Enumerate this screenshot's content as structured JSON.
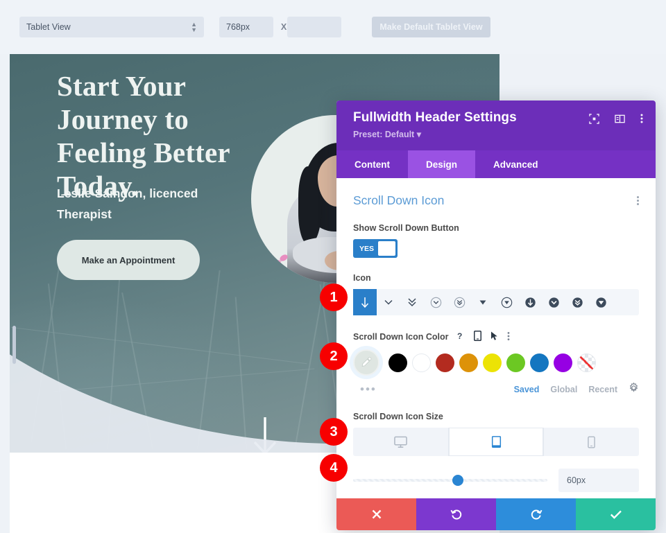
{
  "toolbar": {
    "view_select": "Tablet View",
    "width_value": "768px",
    "multiply_symbol": "X",
    "height_value": "",
    "make_default_button": "Make Default Tablet View"
  },
  "preview": {
    "heading": "Start Your Journey to Feeling Better Today.",
    "subheading": "Leslie Saindon, licenced Therapist",
    "cta_button": "Make an Appointment",
    "scroll_arrow_icon": "arrow-down-icon",
    "hero_bg_color": "#5a777b"
  },
  "modal": {
    "title": "Fullwidth Header Settings",
    "preset": "Preset: Default",
    "header_icons": [
      "target-icon",
      "layout-icon",
      "kebab-menu-icon"
    ],
    "tabs": [
      {
        "label": "Content",
        "active": false
      },
      {
        "label": "Design",
        "active": true
      },
      {
        "label": "Advanced",
        "active": false
      }
    ],
    "section": {
      "title": "Scroll Down Icon",
      "kebab": "kebab-menu-icon"
    },
    "show_scroll_down": {
      "label": "Show Scroll Down Button",
      "toggle_value": "YES",
      "toggle_on": true,
      "accent": "#2a7fc9"
    },
    "icon_field": {
      "label": "Icon",
      "selected_index": 0,
      "options": [
        "arrow-down-icon",
        "chevron-down-icon",
        "double-chevron-down-icon",
        "circle-chevron-down-outline-icon",
        "circle-double-chevron-down-outline-icon",
        "triangle-down-icon",
        "circle-triangle-down-outline-icon",
        "circle-arrow-down-filled-icon",
        "circle-chevron-down-filled-icon",
        "circle-double-chevron-down-filled-icon",
        "circle-triangle-down-filled-icon"
      ]
    },
    "color_field": {
      "label": "Scroll Down Icon Color",
      "label_icons": [
        "help-icon",
        "tablet-icon",
        "cursor-icon",
        "kebab-menu-icon"
      ],
      "eyedropper": "eyedropper-icon",
      "swatches": [
        {
          "name": "black",
          "hex": "#000000"
        },
        {
          "name": "white",
          "hex": "#ffffff"
        },
        {
          "name": "red",
          "hex": "#b32b1f"
        },
        {
          "name": "orange",
          "hex": "#dd9209"
        },
        {
          "name": "yellow",
          "hex": "#ece305"
        },
        {
          "name": "green",
          "hex": "#6cc823"
        },
        {
          "name": "blue",
          "hex": "#1476c0"
        },
        {
          "name": "purple",
          "hex": "#9600e3"
        },
        {
          "name": "none",
          "hex": "transparent"
        }
      ],
      "more_dots": "•••",
      "palette_tabs": [
        {
          "label": "Saved",
          "active": true
        },
        {
          "label": "Global",
          "active": false
        },
        {
          "label": "Recent",
          "active": false
        }
      ],
      "settings_icon": "gear-icon"
    },
    "size_field": {
      "label": "Scroll Down Icon Size",
      "devices": [
        {
          "name": "desktop-icon",
          "active": false
        },
        {
          "name": "tablet-icon",
          "active": true
        },
        {
          "name": "phone-icon",
          "active": false
        }
      ],
      "slider_value": "60px",
      "slider_percent": 54
    },
    "footer": [
      {
        "name": "cancel-button",
        "icon": "close-icon",
        "color": "#eb5a56"
      },
      {
        "name": "reset-button",
        "icon": "undo-icon",
        "color": "#7c38cf"
      },
      {
        "name": "redo-button",
        "icon": "redo-icon",
        "color": "#2d8ddb"
      },
      {
        "name": "save-button",
        "icon": "check-icon",
        "color": "#2ac0a0"
      }
    ]
  },
  "badges": [
    {
      "num": "1"
    },
    {
      "num": "2"
    },
    {
      "num": "3"
    },
    {
      "num": "4"
    }
  ]
}
